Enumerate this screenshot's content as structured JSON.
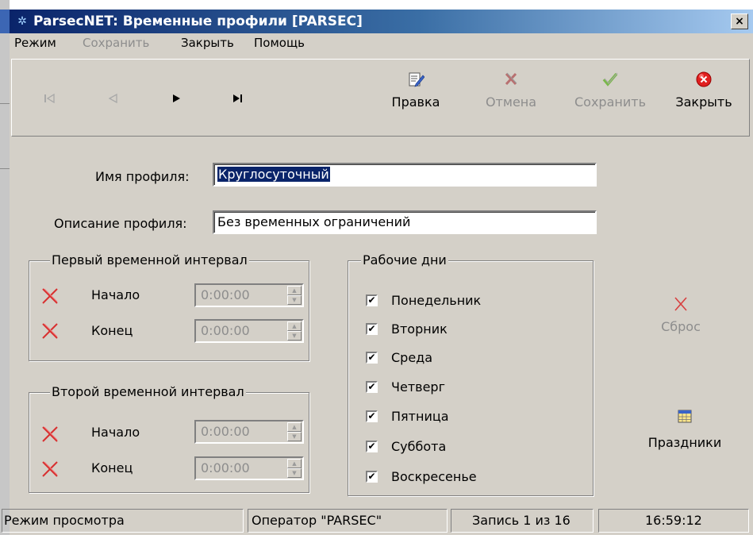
{
  "window": {
    "title": "ParsecNET: Временные профили [PARSEC]",
    "close_glyph": "×"
  },
  "menu": [
    {
      "label": "Режим",
      "enabled": true
    },
    {
      "label": "Сохранить",
      "enabled": false
    },
    {
      "label": "Закрыть",
      "enabled": true
    },
    {
      "label": "Помощь",
      "enabled": true
    }
  ],
  "toolbar": {
    "nav": [
      {
        "glyph": "⏮",
        "icon": "first-record-icon",
        "enabled": false
      },
      {
        "glyph": "◁",
        "icon": "prev-record-icon",
        "enabled": false
      },
      {
        "glyph": "▶",
        "icon": "next-record-icon",
        "enabled": true
      },
      {
        "glyph": "▶|",
        "icon": "last-record-icon",
        "enabled": true
      }
    ],
    "edit_label": "Правка",
    "cancel_label": "Отмена",
    "save_label": "Сохранить",
    "close_label": "Закрыть"
  },
  "form": {
    "profile_name_label": "Имя профиля:",
    "profile_name_value": "Круглосуточный",
    "profile_desc_label": "Описание профиля:",
    "profile_desc_value": "Без временных ограничений",
    "interval1": {
      "caption": "Первый временной интервал",
      "start_label": "Начало",
      "start_value": "0:00:00",
      "end_label": "Конец",
      "end_value": "0:00:00"
    },
    "interval2": {
      "caption": "Второй временной интервал",
      "start_label": "Начало",
      "start_value": "0:00:00",
      "end_label": "Конец",
      "end_value": "0:00:00"
    },
    "workdays": {
      "caption": "Рабочие дни",
      "days": [
        {
          "label": "Понедельник",
          "checked": true
        },
        {
          "label": "Вторник",
          "checked": true
        },
        {
          "label": "Среда",
          "checked": true
        },
        {
          "label": "Четверг",
          "checked": true
        },
        {
          "label": "Пятница",
          "checked": true
        },
        {
          "label": "Суббота",
          "checked": true
        },
        {
          "label": "Воскресенье",
          "checked": true
        }
      ]
    },
    "reset_label": "Сброс",
    "holidays_label": "Праздники"
  },
  "status": {
    "mode": "Режим просмотра",
    "operator": "Оператор \"PARSEC\"",
    "record": "Запись 1 из 16",
    "time": "16:59:12"
  },
  "colors": {
    "title_active": "#0a246a",
    "window_face": "#d4d0c8",
    "selection": "#0a246a",
    "disabled_text": "#8d8d8d",
    "red_x": "#d83030"
  }
}
